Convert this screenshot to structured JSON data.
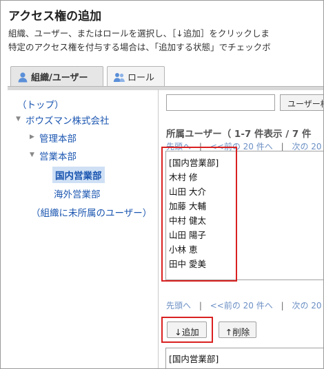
{
  "header": {
    "title": "アクセス権の追加",
    "desc1": "組織、ユーザー、またはロールを選択し、［↓追加］をクリックしま",
    "desc2": "特定のアクセス権を付与する場合は、「追加する状態」でチェックボ"
  },
  "tabs": [
    {
      "label": "組織/ユーザー",
      "active": true
    },
    {
      "label": "ロール",
      "active": false
    }
  ],
  "tree": {
    "top": "（トップ）",
    "company": "ボウズマン株式会社",
    "admin": "管理本部",
    "sales": "営業本部",
    "domestic": "国内営業部",
    "overseas": "海外営業部",
    "unassigned": "（組織に未所属のユーザー）"
  },
  "search": {
    "value": "",
    "button": "ユーザー検"
  },
  "members": {
    "label": "所属ユーザー（ 1-7 件表示 / 7 件",
    "pager_first": "先頭へ",
    "pager_sep": "|",
    "pager_prev": "<<前の 20 件へ",
    "pager_next": "次の 20",
    "items": [
      "[国内営業部]",
      "木村 修",
      "山田 大介",
      "加藤 大輔",
      "中村 健太",
      "山田 陽子",
      "小林 恵",
      "田中 愛美"
    ]
  },
  "actions": {
    "add": "↓追加",
    "remove": "↑削除"
  },
  "selected": {
    "items": [
      "[国内営業部]"
    ]
  },
  "colors": {
    "accent_link": "#1a55b0",
    "highlight": "#d92020",
    "selected_bg": "#cfe0f5"
  }
}
